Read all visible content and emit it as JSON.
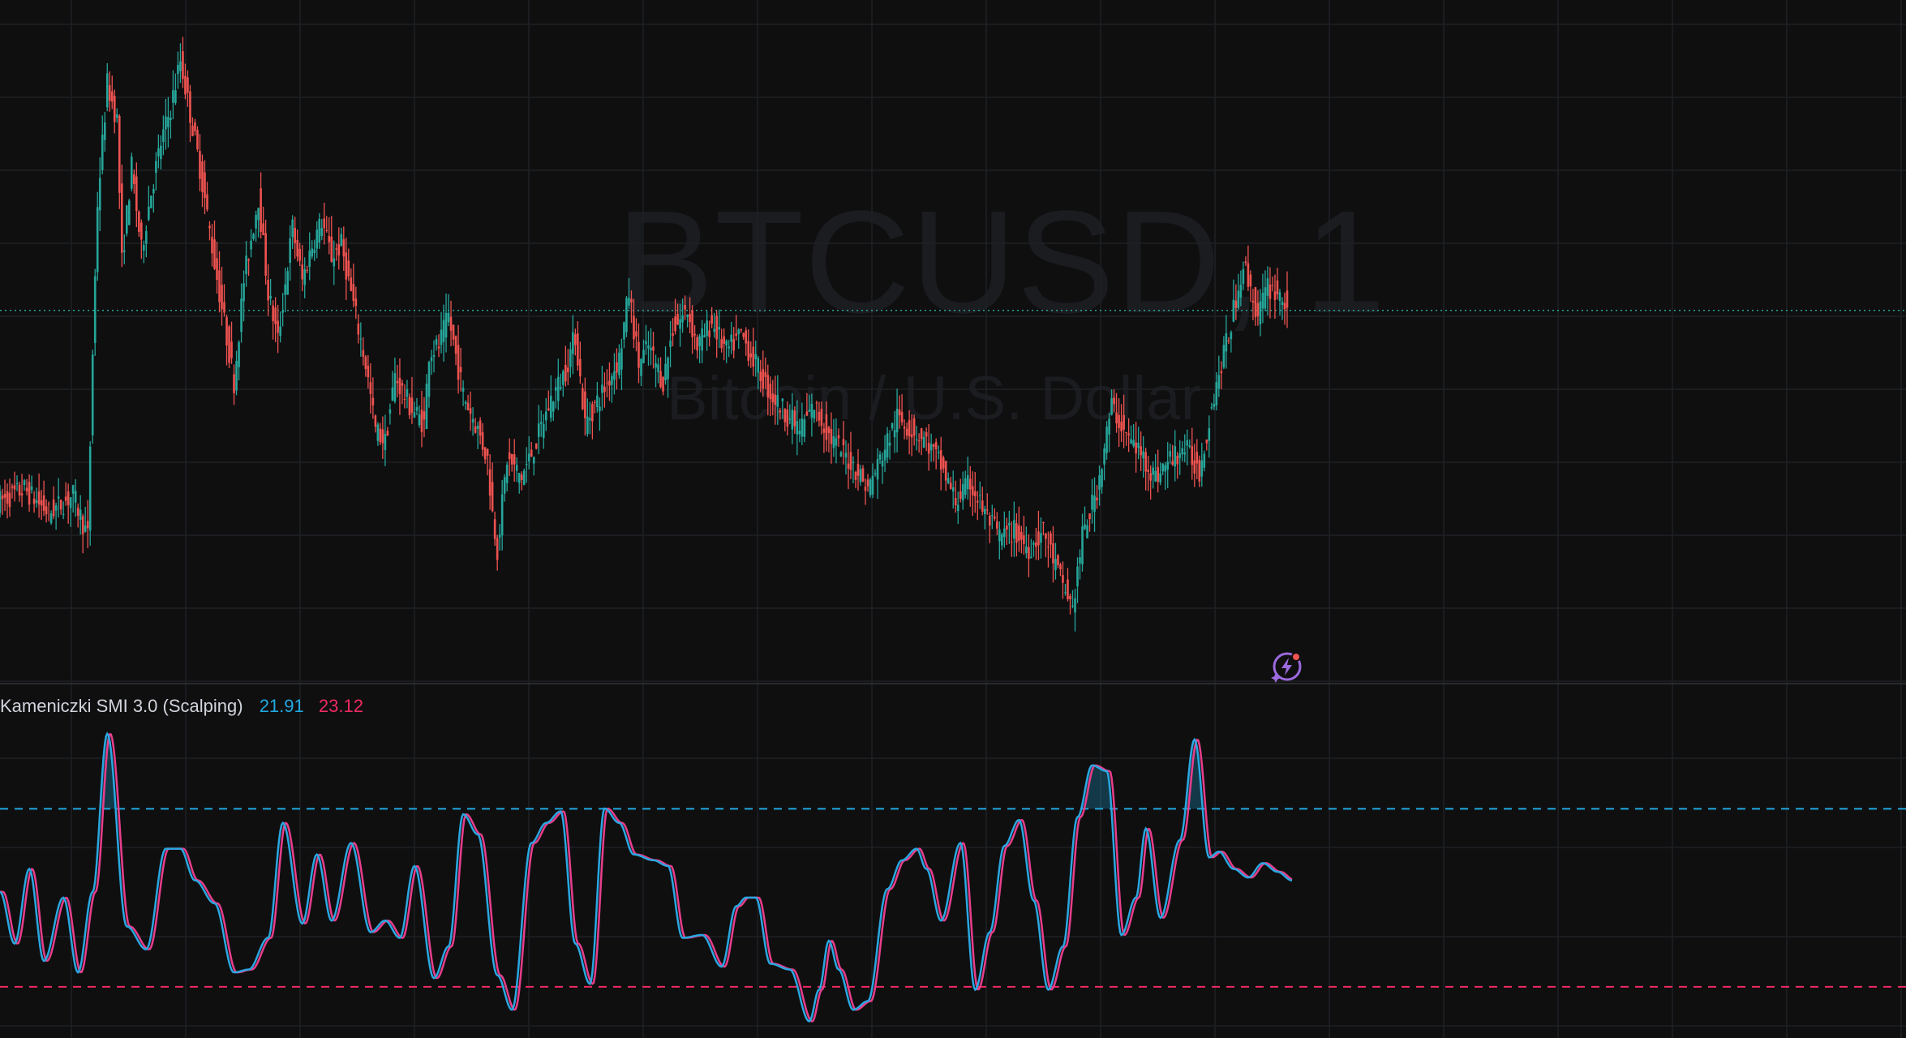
{
  "watermark": {
    "symbol": "BTCUSD, 1",
    "description": "Bitcoin / U.S. Dollar"
  },
  "colors": {
    "background": "#0f0f10",
    "grid": "#1f2024",
    "up": "#26a69a",
    "down": "#ef5350",
    "smi_line": "#2aa7e0",
    "signal_line": "#e83e8c",
    "overbought": "#22a8e0",
    "oversold": "#ef2a62",
    "separator": "#2a2b30",
    "badge": "#9c6ade",
    "badge_dot": "#ef5350"
  },
  "indicator": {
    "name": "Kameniczki SMI 3.0 (Scalping)",
    "value_smi": "21.91",
    "value_signal": "23.12"
  },
  "badge_icon": "lightning-sparkle-icon",
  "chart_data": [
    {
      "type": "candlestick",
      "title": "BTCUSD, 1",
      "subtitle": "Bitcoin / U.S. Dollar",
      "y_relative_range": [
        0,
        100
      ],
      "price_line_level": 52,
      "price_path": [
        [
          0,
          20
        ],
        [
          5,
          22
        ],
        [
          10,
          18
        ],
        [
          15,
          21
        ],
        [
          18,
          14
        ],
        [
          19,
          45
        ],
        [
          20,
          70
        ],
        [
          22,
          90
        ],
        [
          24,
          84
        ],
        [
          25,
          60
        ],
        [
          27,
          76
        ],
        [
          29,
          62
        ],
        [
          31,
          72
        ],
        [
          33,
          80
        ],
        [
          35,
          86
        ],
        [
          37,
          94
        ],
        [
          39,
          85
        ],
        [
          41,
          76
        ],
        [
          44,
          60
        ],
        [
          46,
          50
        ],
        [
          48,
          40
        ],
        [
          50,
          57
        ],
        [
          53,
          71
        ],
        [
          55,
          55
        ],
        [
          57,
          47
        ],
        [
          60,
          66
        ],
        [
          62,
          57
        ],
        [
          64,
          63
        ],
        [
          66,
          67
        ],
        [
          68,
          61
        ],
        [
          70,
          63
        ],
        [
          72,
          55
        ],
        [
          75,
          43
        ],
        [
          77,
          32
        ],
        [
          79,
          30
        ],
        [
          81,
          41
        ],
        [
          84,
          36
        ],
        [
          87,
          33
        ],
        [
          88,
          45
        ],
        [
          90,
          46
        ],
        [
          92,
          51
        ],
        [
          95,
          38
        ],
        [
          98,
          32
        ],
        [
          100,
          27
        ],
        [
          101,
          18
        ],
        [
          102,
          12
        ],
        [
          104,
          27
        ],
        [
          107,
          24
        ],
        [
          110,
          30
        ],
        [
          113,
          37
        ],
        [
          116,
          42
        ],
        [
          118,
          48
        ],
        [
          120,
          33
        ],
        [
          124,
          39
        ],
        [
          127,
          44
        ],
        [
          129,
          55
        ],
        [
          131,
          43
        ],
        [
          133,
          46
        ],
        [
          136,
          40
        ],
        [
          138,
          49
        ],
        [
          141,
          52
        ],
        [
          143,
          46
        ],
        [
          146,
          50
        ],
        [
          149,
          45
        ],
        [
          152,
          48
        ],
        [
          155,
          43
        ],
        [
          158,
          38
        ],
        [
          161,
          35
        ],
        [
          164,
          32
        ],
        [
          167,
          36
        ],
        [
          170,
          31
        ],
        [
          173,
          28
        ],
        [
          176,
          25
        ],
        [
          178,
          22
        ],
        [
          181,
          28
        ],
        [
          184,
          34
        ],
        [
          187,
          32
        ],
        [
          190,
          30
        ],
        [
          193,
          26
        ],
        [
          196,
          20
        ],
        [
          199,
          23
        ],
        [
          202,
          18
        ],
        [
          205,
          14
        ],
        [
          208,
          15
        ],
        [
          211,
          12
        ],
        [
          214,
          15
        ],
        [
          217,
          8
        ],
        [
          220,
          2
        ],
        [
          222,
          14
        ],
        [
          225,
          22
        ],
        [
          228,
          36
        ],
        [
          231,
          31
        ],
        [
          234,
          28
        ],
        [
          237,
          24
        ],
        [
          240,
          27
        ],
        [
          243,
          29
        ],
        [
          246,
          25
        ],
        [
          249,
          38
        ],
        [
          252,
          48
        ],
        [
          255,
          60
        ],
        [
          258,
          51
        ],
        [
          260,
          56
        ],
        [
          262,
          55
        ],
        [
          264,
          53
        ]
      ]
    },
    {
      "type": "line",
      "title": "Kameniczki SMI 3.0 (Scalping)",
      "series": [
        {
          "name": "SMI",
          "color": "#2aa7e0"
        },
        {
          "name": "Signal",
          "color": "#e83e8c"
        }
      ],
      "ylim": [
        -55,
        55
      ],
      "levels": [
        {
          "value": 21.91,
          "color": "#22a8e0"
        },
        {
          "value": -40,
          "color": "#ef2a62"
        }
      ],
      "smi_path": [
        [
          0,
          -7
        ],
        [
          3,
          -25
        ],
        [
          6,
          1
        ],
        [
          9,
          -31
        ],
        [
          13,
          -9
        ],
        [
          16,
          -35
        ],
        [
          19,
          -7
        ],
        [
          22,
          48
        ],
        [
          26,
          -19
        ],
        [
          30,
          -27
        ],
        [
          34,
          8
        ],
        [
          37,
          8
        ],
        [
          40,
          -3
        ],
        [
          44,
          -11
        ],
        [
          48,
          -35
        ],
        [
          51,
          -34
        ],
        [
          55,
          -23
        ],
        [
          58,
          17
        ],
        [
          62,
          -18
        ],
        [
          65,
          6
        ],
        [
          68,
          -17
        ],
        [
          72,
          10
        ],
        [
          76,
          -21
        ],
        [
          79,
          -17
        ],
        [
          82,
          -23
        ],
        [
          85,
          2
        ],
        [
          89,
          -37
        ],
        [
          92,
          -26
        ],
        [
          95,
          20
        ],
        [
          98,
          13
        ],
        [
          102,
          -36
        ],
        [
          105,
          -48
        ],
        [
          109,
          10
        ],
        [
          112,
          17
        ],
        [
          115,
          21
        ],
        [
          118,
          -25
        ],
        [
          121,
          -39
        ],
        [
          124,
          22
        ],
        [
          127,
          17
        ],
        [
          130,
          6
        ],
        [
          134,
          4
        ],
        [
          137,
          2
        ],
        [
          140,
          -23
        ],
        [
          144,
          -22
        ],
        [
          148,
          -33
        ],
        [
          151,
          -12
        ],
        [
          153,
          -9
        ],
        [
          155,
          -9
        ],
        [
          158,
          -32
        ],
        [
          162,
          -34
        ],
        [
          166,
          -52
        ],
        [
          168,
          -41
        ],
        [
          170,
          -24
        ],
        [
          172,
          -34
        ],
        [
          175,
          -48
        ],
        [
          178,
          -45
        ],
        [
          182,
          -6
        ],
        [
          185,
          4
        ],
        [
          188,
          8
        ],
        [
          190,
          1
        ],
        [
          193,
          -17
        ],
        [
          197,
          10
        ],
        [
          200,
          -41
        ],
        [
          203,
          -21
        ],
        [
          206,
          9
        ],
        [
          209,
          18
        ],
        [
          212,
          -10
        ],
        [
          215,
          -41
        ],
        [
          218,
          -26
        ],
        [
          221,
          19
        ],
        [
          224,
          37
        ],
        [
          227,
          35
        ],
        [
          230,
          -22
        ],
        [
          233,
          -9
        ],
        [
          235,
          15
        ],
        [
          238,
          -16
        ],
        [
          242,
          11
        ],
        [
          245,
          46
        ],
        [
          248,
          5
        ],
        [
          250,
          7
        ],
        [
          253,
          1
        ],
        [
          256,
          -2
        ],
        [
          259,
          3
        ],
        [
          262,
          0
        ],
        [
          265,
          -3
        ]
      ]
    }
  ]
}
